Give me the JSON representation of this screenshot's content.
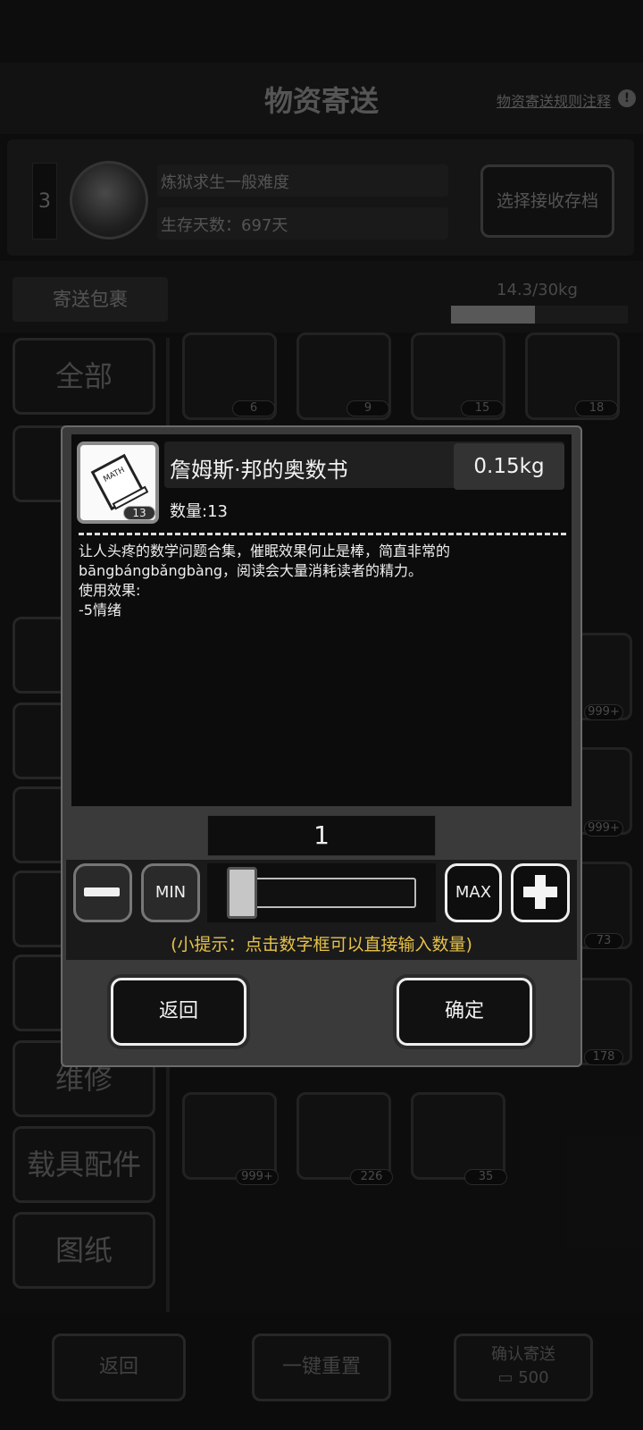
{
  "header": {
    "title": "物资寄送",
    "rules_link": "物资寄送规则注释",
    "info_icon": "info-icon"
  },
  "profile": {
    "slot_number": "3",
    "save_name": "炼狱求生一般难度",
    "survival_days": "生存天数：697天",
    "select_save_label": "选择接收存档"
  },
  "package": {
    "label": "寄送包裹",
    "weight": "14.3/30kg",
    "fill_fraction": 0.477
  },
  "sidebar": {
    "categories": [
      "全部",
      "维修",
      "载具配件",
      "图纸"
    ]
  },
  "grid": {
    "row1_counts": [
      "6",
      "9",
      "15",
      "18"
    ],
    "side_counts": [
      "999+",
      "999+",
      "73",
      "178"
    ],
    "row_last_counts": [
      "999+",
      "226",
      "35"
    ]
  },
  "modal": {
    "item_name": "詹姆斯·邦的奥数书",
    "item_weight": "0.15kg",
    "item_quantity": "数量:13",
    "item_badge": "13",
    "book_cover_text": "MATH",
    "description_lines": [
      "让人头疼的数学问题合集，催眠效果何止是棒，简直非常的",
      "bāngbángbǎngbàng，阅读会大量消耗读者的精力。",
      "使用效果:",
      "-5情绪"
    ],
    "selected_quantity": "1",
    "min_label": "MIN",
    "max_label": "MAX",
    "slider_value": 1,
    "hint": "(小提示：点击数字框可以直接输入数量)",
    "back_label": "返回",
    "confirm_label": "确定"
  },
  "bottom": {
    "back_label": "返回",
    "reset_label": "一键重置",
    "confirm_send_label": "确认寄送",
    "cost": "500"
  }
}
